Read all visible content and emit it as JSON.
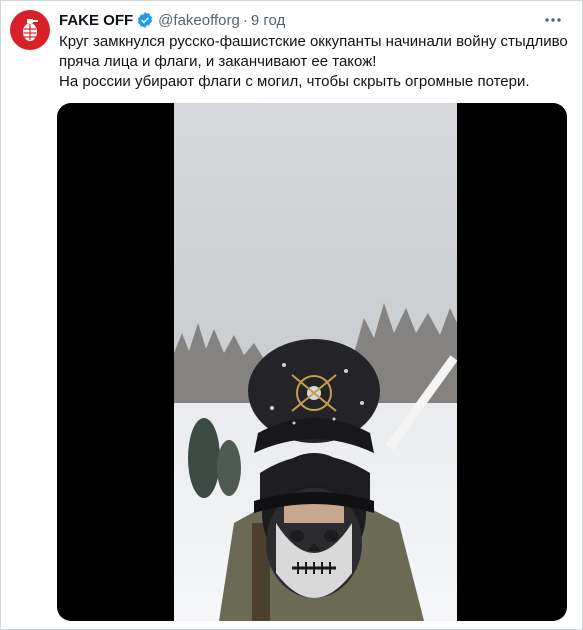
{
  "tweet": {
    "author_name": "FAKE OFF",
    "handle": "@fakeofforg",
    "separator": "·",
    "time": "9 год",
    "text_line_1": "Круг замкнулся русско-фашистские оккупанты начинали войну стыдливо пряча лица и флаги, и заканчивают ее також!",
    "text_line_2": "На россии убирают флаги с могил, чтобы скрыть огромные потери."
  },
  "icons": {
    "avatar": "grenade-logo-icon",
    "verified": "verified-badge-icon",
    "more": "more-dots-icon"
  },
  "colors": {
    "avatar_bg": "#d8202a",
    "verified": "#1d9bf0",
    "secondary_text": "#536471",
    "media_bg": "#000000"
  }
}
